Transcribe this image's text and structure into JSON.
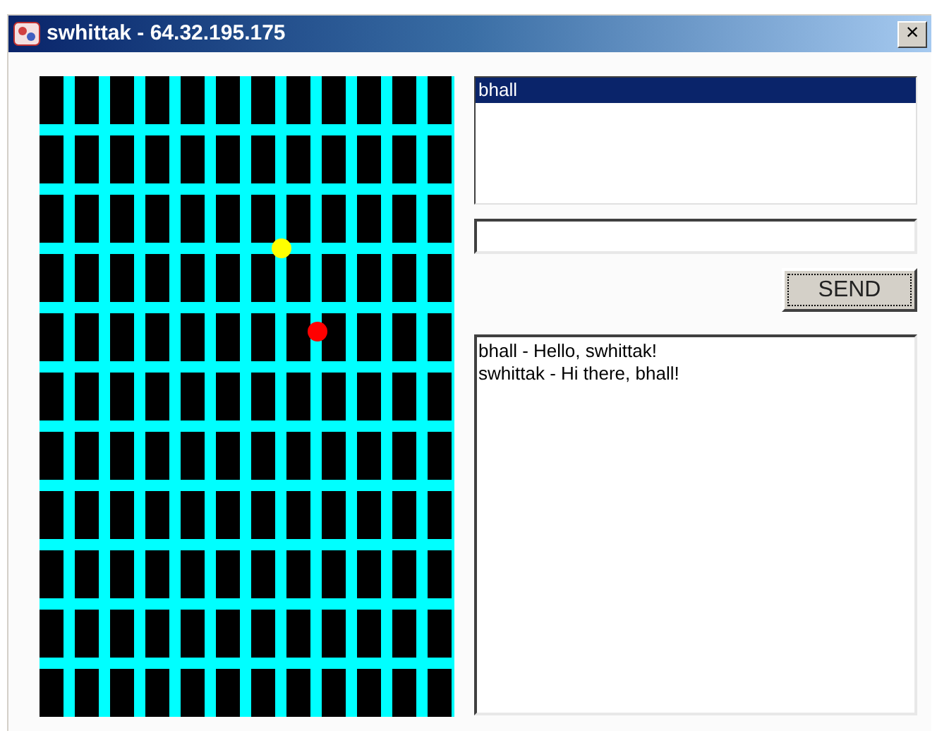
{
  "window": {
    "title": "swhittak - 64.32.195.175",
    "close": "×"
  },
  "board": {
    "tokens": [
      {
        "color": "#ffff00"
      },
      {
        "color": "#ff0000"
      }
    ]
  },
  "users": [
    {
      "name": "bhall",
      "selected": true
    }
  ],
  "send_button": "SEND",
  "chat": [
    "bhall - Hello, swhittak!",
    "swhittak - Hi there, bhall!"
  ]
}
